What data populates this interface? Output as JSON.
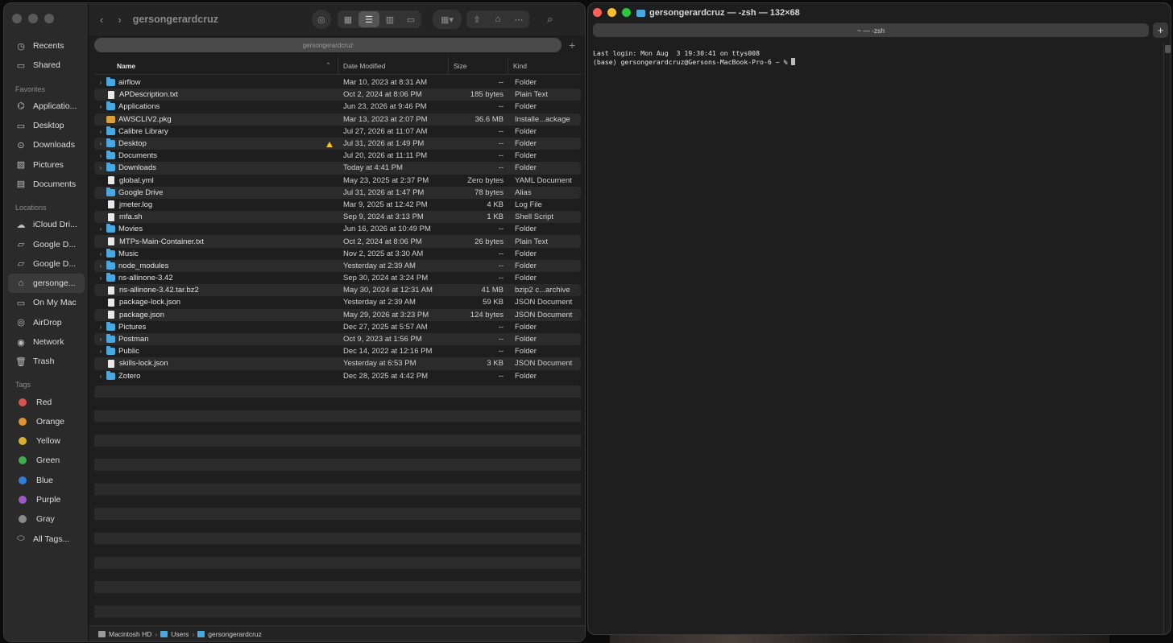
{
  "finder": {
    "title": "gersongerardcruz",
    "path_field": "gersongerardcruz",
    "sidebar": {
      "recents": "Recents",
      "shared": "Shared",
      "favorites_header": "Favorites",
      "favorites": [
        "Applicatio...",
        "Desktop",
        "Downloads",
        "Pictures",
        "Documents"
      ],
      "locations_header": "Locations",
      "locations": [
        "iCloud Dri...",
        "Google D...",
        "Google D...",
        "gersonge...",
        "On My Mac",
        "AirDrop",
        "Network",
        "Trash"
      ],
      "tags_header": "Tags",
      "tags": [
        {
          "label": "Red",
          "color": "#d9534f"
        },
        {
          "label": "Orange",
          "color": "#e0922f"
        },
        {
          "label": "Yellow",
          "color": "#d6b32a"
        },
        {
          "label": "Green",
          "color": "#3fae4a"
        },
        {
          "label": "Blue",
          "color": "#2f7fd9"
        },
        {
          "label": "Purple",
          "color": "#9b59c6"
        },
        {
          "label": "Gray",
          "color": "#8a8a8a"
        }
      ],
      "all_tags": "All Tags..."
    },
    "columns": {
      "name": "Name",
      "date": "Date Modified",
      "size": "Size",
      "kind": "Kind"
    },
    "files": [
      {
        "name": "airflow",
        "date": "Mar 10, 2023 at 8:31 AM",
        "size": "--",
        "kind": "Folder",
        "type": "folder"
      },
      {
        "name": "APDescription.txt",
        "date": "Oct 2, 2024 at 8:06 PM",
        "size": "185 bytes",
        "kind": "Plain Text",
        "type": "doc"
      },
      {
        "name": "Applications",
        "date": "Jun 23, 2026 at 9:46 PM",
        "size": "--",
        "kind": "Folder",
        "type": "folder"
      },
      {
        "name": "AWSCLIV2.pkg",
        "date": "Mar 13, 2023 at 2:07 PM",
        "size": "36.6 MB",
        "kind": "Installe...ackage",
        "type": "pkg"
      },
      {
        "name": "Calibre Library",
        "date": "Jul 27, 2026 at 11:07 AM",
        "size": "--",
        "kind": "Folder",
        "type": "folder"
      },
      {
        "name": "Desktop",
        "date": "Jul 31, 2026 at 1:49 PM",
        "size": "--",
        "kind": "Folder",
        "type": "folder"
      },
      {
        "name": "Documents",
        "date": "Jul 20, 2026 at 11:11 PM",
        "size": "--",
        "kind": "Folder",
        "type": "folder"
      },
      {
        "name": "Downloads",
        "date": "Today at 4:41 PM",
        "size": "--",
        "kind": "Folder",
        "type": "folder"
      },
      {
        "name": "global.yml",
        "date": "May 23, 2025 at 2:37 PM",
        "size": "Zero bytes",
        "kind": "YAML Document",
        "type": "doc"
      },
      {
        "name": "Google Drive",
        "date": "Jul 31, 2026 at 1:47 PM",
        "size": "78 bytes",
        "kind": "Alias",
        "type": "alias"
      },
      {
        "name": "jmeter.log",
        "date": "Mar 9, 2025 at 12:42 PM",
        "size": "4 KB",
        "kind": "Log File",
        "type": "doc"
      },
      {
        "name": "mfa.sh",
        "date": "Sep 9, 2024 at 3:13 PM",
        "size": "1 KB",
        "kind": "Shell Script",
        "type": "doc"
      },
      {
        "name": "Movies",
        "date": "Jun 16, 2026 at 10:49 PM",
        "size": "--",
        "kind": "Folder",
        "type": "folder"
      },
      {
        "name": "MTPs-Main-Container.txt",
        "date": "Oct 2, 2024 at 8:06 PM",
        "size": "26 bytes",
        "kind": "Plain Text",
        "type": "doc"
      },
      {
        "name": "Music",
        "date": "Nov 2, 2025 at 3:30 AM",
        "size": "--",
        "kind": "Folder",
        "type": "folder"
      },
      {
        "name": "node_modules",
        "date": "Yesterday at 2:39 AM",
        "size": "--",
        "kind": "Folder",
        "type": "folder"
      },
      {
        "name": "ns-allinone-3.42",
        "date": "Sep 30, 2024 at 3:24 PM",
        "size": "--",
        "kind": "Folder",
        "type": "folder"
      },
      {
        "name": "ns-allinone-3.42.tar.bz2",
        "date": "May 30, 2024 at 12:31 AM",
        "size": "41 MB",
        "kind": "bzip2 c...archive",
        "type": "doc"
      },
      {
        "name": "package-lock.json",
        "date": "Yesterday at 2:39 AM",
        "size": "59 KB",
        "kind": "JSON Document",
        "type": "doc"
      },
      {
        "name": "package.json",
        "date": "May 29, 2026 at 3:23 PM",
        "size": "124 bytes",
        "kind": "JSON Document",
        "type": "doc"
      },
      {
        "name": "Pictures",
        "date": "Dec 27, 2025 at 5:57 AM",
        "size": "--",
        "kind": "Folder",
        "type": "folder"
      },
      {
        "name": "Postman",
        "date": "Oct 9, 2023 at 1:56 PM",
        "size": "--",
        "kind": "Folder",
        "type": "folder"
      },
      {
        "name": "Public",
        "date": "Dec 14, 2022 at 12:16 PM",
        "size": "--",
        "kind": "Folder",
        "type": "folder"
      },
      {
        "name": "skills-lock.json",
        "date": "Yesterday at 6:53 PM",
        "size": "3 KB",
        "kind": "JSON Document",
        "type": "doc"
      },
      {
        "name": "Zotero",
        "date": "Dec 28, 2025 at 4:42 PM",
        "size": "--",
        "kind": "Folder",
        "type": "folder"
      }
    ],
    "breadcrumb": [
      "Macintosh HD",
      "Users",
      "gersongerardcruz"
    ]
  },
  "terminal": {
    "title": "gersongerardcruz — -zsh — 132×68",
    "tab_label": "~ — -zsh",
    "lines": [
      "Last login: Mon Aug  3 19:30:41 on ttys008",
      "(base) gersongerardcruz@Gersons-MacBook-Pro-6 ~ % "
    ],
    "light_colors": [
      "#ff5f57",
      "#febc2e",
      "#28c840"
    ]
  }
}
